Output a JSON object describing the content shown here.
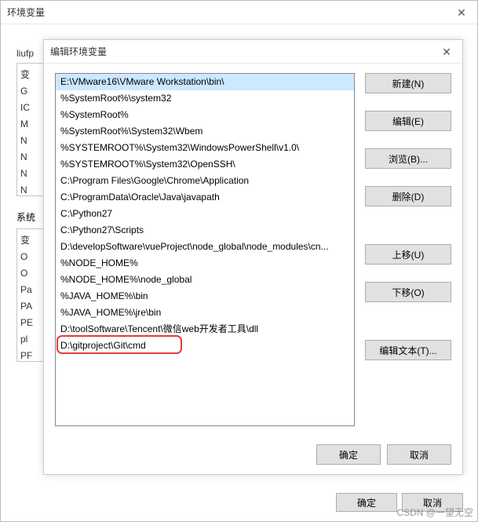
{
  "parent_window": {
    "title": "环境变量",
    "close_glyph": "✕",
    "user_prefix": "liufp",
    "user_vars_header": "变",
    "user_rows": [
      "G",
      "IC",
      "M",
      "N",
      "N",
      "N",
      "N"
    ],
    "system_label": "系统",
    "system_header": "变",
    "system_rows": [
      "O",
      "O",
      "Pa",
      "PA",
      "PE",
      "pl",
      "PF"
    ],
    "ok_label": "确定",
    "cancel_label": "取消"
  },
  "modal": {
    "title": "编辑环境变量",
    "close_glyph": "✕",
    "paths": [
      "E:\\VMware16\\VMware Workstation\\bin\\",
      "%SystemRoot%\\system32",
      "%SystemRoot%",
      "%SystemRoot%\\System32\\Wbem",
      "%SYSTEMROOT%\\System32\\WindowsPowerShell\\v1.0\\",
      "%SYSTEMROOT%\\System32\\OpenSSH\\",
      "C:\\Program Files\\Google\\Chrome\\Application",
      "C:\\ProgramData\\Oracle\\Java\\javapath",
      "C:\\Python27",
      "C:\\Python27\\Scripts",
      "D:\\developSoftware\\vueProject\\node_global\\node_modules\\cn...",
      "%NODE_HOME%",
      "%NODE_HOME%\\node_global",
      "%JAVA_HOME%\\bin",
      "%JAVA_HOME%\\jre\\bin",
      "D:\\toolSoftware\\Tencent\\微信web开发者工具\\dll",
      "D:\\gitproject\\Git\\cmd"
    ],
    "selected_index": 0,
    "highlighted_index": 16,
    "buttons": {
      "new": "新建(N)",
      "edit": "编辑(E)",
      "browse": "浏览(B)...",
      "delete": "删除(D)",
      "move_up": "上移(U)",
      "move_down": "下移(O)",
      "edit_text": "编辑文本(T)..."
    },
    "ok_label": "确定",
    "cancel_label": "取消"
  },
  "watermark": "CSDN @一望无空"
}
